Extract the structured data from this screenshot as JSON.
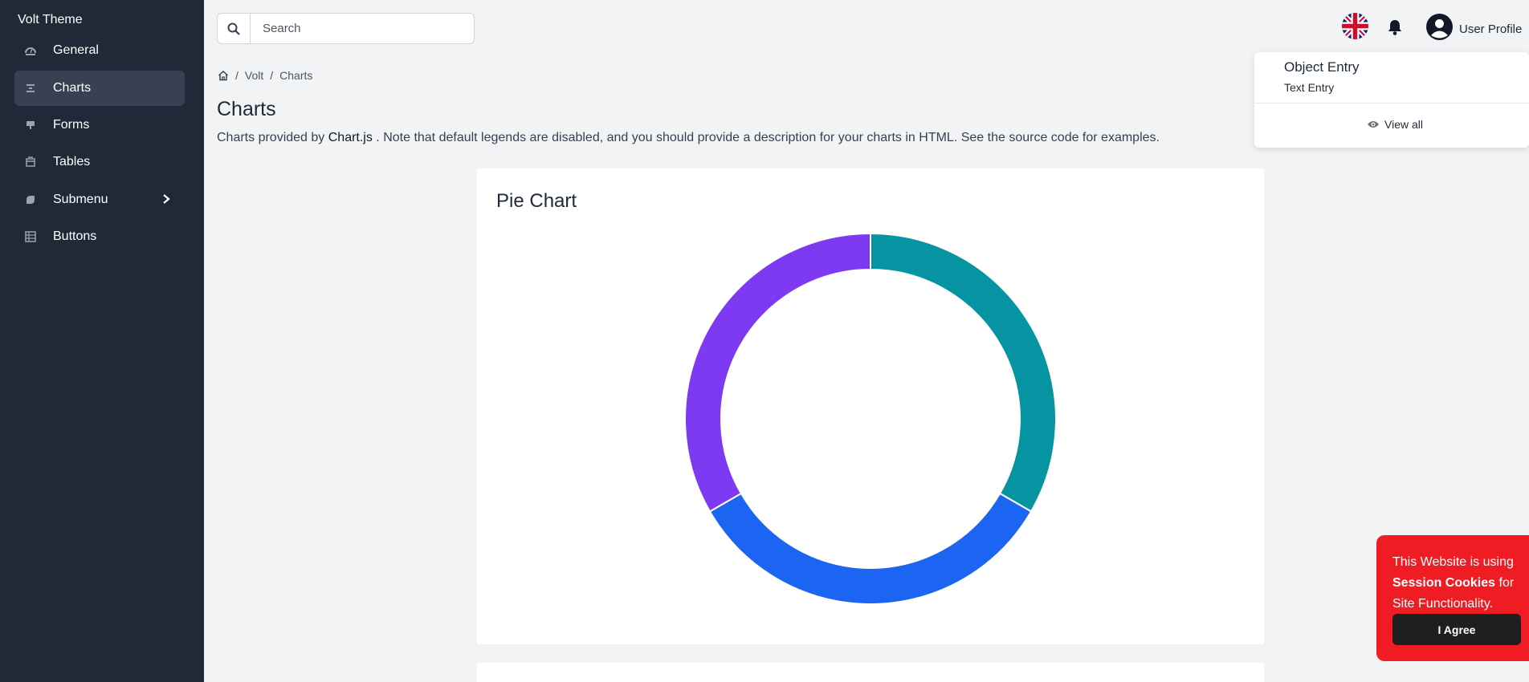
{
  "sidebar": {
    "brand": "Volt Theme",
    "items": [
      {
        "label": "General",
        "icon": "dashboard-icon"
      },
      {
        "label": "Charts",
        "icon": "chart-icon",
        "active": true
      },
      {
        "label": "Forms",
        "icon": "forms-icon"
      },
      {
        "label": "Tables",
        "icon": "table-icon"
      },
      {
        "label": "Submenu",
        "icon": "submenu-icon",
        "has_children": true
      },
      {
        "label": "Buttons",
        "icon": "grid-icon"
      }
    ]
  },
  "topbar": {
    "search_placeholder": "Search",
    "user_name": "User Profile"
  },
  "dropdown": {
    "title": "Object Entry",
    "subtitle": "Text Entry",
    "view_all": "View all"
  },
  "breadcrumb": [
    "Volt",
    "Charts"
  ],
  "page": {
    "title": "Charts",
    "desc_prefix": "Charts provided by ",
    "desc_link": "Chart.js",
    "desc_suffix": " . Note that default legends are disabled, and you should provide a description for your charts in HTML. See the source code for examples."
  },
  "chart_data": {
    "type": "pie",
    "title": "Pie Chart",
    "values": [
      1,
      1,
      1
    ],
    "colors": [
      "#0694a2",
      "#1c64f2",
      "#7e3af2"
    ]
  },
  "cookie": {
    "line1": "This Website is using",
    "bold": "Session Cookies",
    "line2": " for Site Functionality.",
    "button": "I Agree"
  },
  "colors": {
    "sidebar_bg": "#1f2937",
    "cookie_bg": "#ef1c24"
  }
}
